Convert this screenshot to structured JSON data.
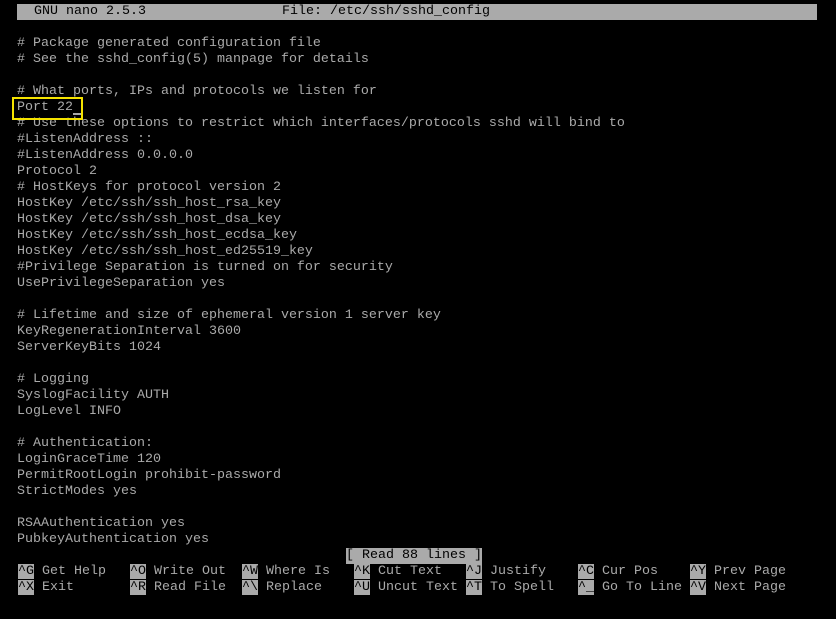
{
  "title_bar": {
    "app": "GNU nano 2.5.3",
    "file": "File: /etc/ssh/sshd_config"
  },
  "lines": [
    "# Package generated configuration file",
    "# See the sshd_config(5) manpage for details",
    "",
    "# What ports, IPs and protocols we listen for",
    "Port 22",
    "# Use these options to restrict which interfaces/protocols sshd will bind to",
    "#ListenAddress ::",
    "#ListenAddress 0.0.0.0",
    "Protocol 2",
    "# HostKeys for protocol version 2",
    "HostKey /etc/ssh/ssh_host_rsa_key",
    "HostKey /etc/ssh/ssh_host_dsa_key",
    "HostKey /etc/ssh/ssh_host_ecdsa_key",
    "HostKey /etc/ssh/ssh_host_ed25519_key",
    "#Privilege Separation is turned on for security",
    "UsePrivilegeSeparation yes",
    "",
    "# Lifetime and size of ephemeral version 1 server key",
    "KeyRegenerationInterval 3600",
    "ServerKeyBits 1024",
    "",
    "# Logging",
    "SyslogFacility AUTH",
    "LogLevel INFO",
    "",
    "# Authentication:",
    "LoginGraceTime 120",
    "PermitRootLogin prohibit-password",
    "StrictModes yes",
    "",
    "RSAAuthentication yes",
    "PubkeyAuthentication yes"
  ],
  "status": "[ Read 88 lines ]",
  "shortcuts": [
    {
      "key": "^G",
      "label": "Get Help"
    },
    {
      "key": "^O",
      "label": "Write Out"
    },
    {
      "key": "^W",
      "label": "Where Is"
    },
    {
      "key": "^K",
      "label": "Cut Text"
    },
    {
      "key": "^J",
      "label": "Justify"
    },
    {
      "key": "^C",
      "label": "Cur Pos"
    },
    {
      "key": "^Y",
      "label": "Prev Page"
    },
    {
      "key": "^X",
      "label": "Exit"
    },
    {
      "key": "^R",
      "label": "Read File"
    },
    {
      "key": "^\\",
      "label": "Replace"
    },
    {
      "key": "^U",
      "label": "Uncut Text"
    },
    {
      "key": "^T",
      "label": "To Spell"
    },
    {
      "key": "^_",
      "label": "Go To Line"
    },
    {
      "key": "^V",
      "label": "Next Page"
    }
  ],
  "colors": {
    "highlight_box": "#f5e300",
    "bar_bg": "#aaaaaa",
    "text": "#aaaaaa"
  }
}
